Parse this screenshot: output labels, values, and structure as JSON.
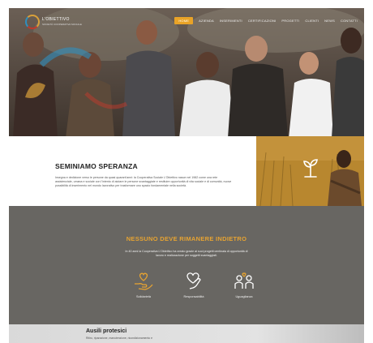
{
  "brand": {
    "logo_text": "L'OBIETTIVO",
    "logo_sub": "SOCIETÀ COOPERATIVA SOCIALE"
  },
  "nav": {
    "items": [
      {
        "label": "Home",
        "active": true
      },
      {
        "label": "Azienda",
        "active": false
      },
      {
        "label": "Inserimenti",
        "active": false
      },
      {
        "label": "Certificazioni",
        "active": false
      },
      {
        "label": "Progetti",
        "active": false
      },
      {
        "label": "Clienti",
        "active": false
      },
      {
        "label": "News",
        "active": false
      },
      {
        "label": "Contatti",
        "active": false
      }
    ]
  },
  "intro": {
    "title": "SEMINIAMO SPERANZA",
    "text": "Insegna e dedizione verso le persone da quasi quarant'anni: la Cooperativa Sociale L'Obiettivo nasce nel 1982 come una rete assistenziale, umana e sociale con l'intento di aiutare le persone svantaggiate e restituire opportunità di vita sociale e di comunità, nuove possibilità di inserimento nel mondo lavorativo per trasformare uno spazio fondamentale nella società."
  },
  "mission": {
    "title": "NESSUNO DEVE RIMANERE INDIETRO",
    "text": "In 40 anni la Cooperativa L'Obiettivo ha creato grazie ai suoi progetti centinaia di opportunità di lavoro e realizzazione per soggetti svantaggiati.",
    "values": [
      {
        "label": "Solidarietà",
        "icon": "hands-heart-icon"
      },
      {
        "label": "Responsabilità",
        "icon": "hand-heart-icon"
      },
      {
        "label": "Uguaglianza",
        "icon": "people-heart-icon"
      }
    ]
  },
  "ausili": {
    "title": "Ausili protesici",
    "text": "Ritiro, riparazione, manutenzione, ricondizionamento e"
  },
  "colors": {
    "accent": "#e9a327",
    "mission_bg": "#686662",
    "mission_title": "#e6a332"
  }
}
